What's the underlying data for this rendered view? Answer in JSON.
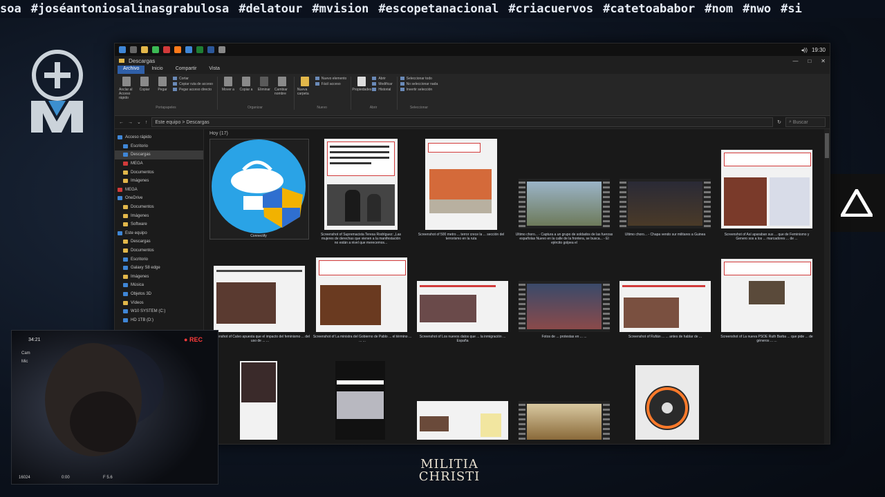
{
  "ticker": [
    "soa",
    "#joséantoniosalinasgrabulosa",
    "#delatour",
    "#mvision",
    "#escopetanacional",
    "#criacuervos",
    "#catetoababor",
    "#nom",
    "#nwo",
    "#si"
  ],
  "colors": {
    "accent": "#2f5fa8",
    "folder": "#e2b74a",
    "rec": "#ff3b3b"
  },
  "watermark": {
    "line1": "MILITIA",
    "line2": "CHRISTI"
  },
  "window": {
    "title": "Descargas",
    "taskbar_time": "19:30",
    "tabs": [
      "Archivo",
      "Inicio",
      "Compartir",
      "Vista"
    ],
    "ribbon": {
      "clipboard": {
        "pin": "Anclar al Acceso rápido",
        "copy": "Copiar",
        "paste": "Pegar",
        "cut": "Cortar",
        "copy_path": "Copiar ruta de acceso",
        "paste_shortcut": "Pegar acceso directo",
        "label": "Portapapeles"
      },
      "organize": {
        "move": "Mover a",
        "copy": "Copiar a",
        "delete": "Eliminar",
        "rename": "Cambiar nombre",
        "label": "Organizar"
      },
      "new": {
        "folder": "Nueva carpeta",
        "new_item": "Nuevo elemento",
        "easy_access": "Fácil acceso",
        "label": "Nuevo"
      },
      "open": {
        "properties": "Propiedades",
        "open": "Abrir",
        "edit": "Modificar",
        "history": "Historial",
        "label": "Abrir"
      },
      "select": {
        "all": "Seleccionar todo",
        "none": "No seleccionar nada",
        "invert": "Invertir selección",
        "label": "Seleccionar"
      }
    },
    "address": "Este equipo  >  Descargas",
    "search_placeholder": "Buscar",
    "nav": [
      {
        "icon": "star",
        "label": "Acceso rápido"
      },
      {
        "icon": "blue",
        "label": "Escritorio"
      },
      {
        "icon": "blue",
        "label": "Descargas",
        "selected": true
      },
      {
        "icon": "red",
        "label": "MEGA"
      },
      {
        "icon": "folder",
        "label": "Documentos"
      },
      {
        "icon": "folder",
        "label": "Imágenes"
      },
      {
        "icon": "red",
        "label": "MEGA"
      },
      {
        "icon": "blue",
        "label": "OneDrive"
      },
      {
        "icon": "folder",
        "label": "Documentos"
      },
      {
        "icon": "folder",
        "label": "Imágenes"
      },
      {
        "icon": "folder",
        "label": "Software"
      },
      {
        "icon": "blue",
        "label": "Este equipo"
      },
      {
        "icon": "folder",
        "label": "Descargas"
      },
      {
        "icon": "folder",
        "label": "Documentos"
      },
      {
        "icon": "blue",
        "label": "Escritorio"
      },
      {
        "icon": "blue",
        "label": "Galaxy S8 edge"
      },
      {
        "icon": "folder",
        "label": "Imágenes"
      },
      {
        "icon": "blue",
        "label": "Música"
      },
      {
        "icon": "blue",
        "label": "Objetos 3D"
      },
      {
        "icon": "folder",
        "label": "Vídeos"
      },
      {
        "icon": "blue",
        "label": "W10 SYSTEM (C:)"
      },
      {
        "icon": "blue",
        "label": "HD 1TB (D:)"
      }
    ],
    "group_header": "Hoy (17)",
    "files": [
      {
        "caption": "Connectify"
      },
      {
        "caption": "Screenshot of Supremacista Teresa Rodríguez: „Las mujeres de derechas que vienen a la manifestación no están a nivel que merecemos..."
      },
      {
        "caption": "Screenshot of 500 metro ... terror crece la ... sección del terrorismo en la ruta"
      },
      {
        "caption": "Último choro... - Captura a un grupo de soldados de las fuerzas españolas Nuevo en la calle de la frontera, se busca... - El ejército golpea el"
      },
      {
        "caption": "Último choro... - Chapa vendo sur militares a Guinea"
      },
      {
        "caption": "Screenshot of Así aparaban sus ... que de Feminismo y Genero sos a los ... marcadores ... de ... "
      },
      {
        "caption": "Screenshot of Calvo apuesta que el impacto del feminismo ... del uso de ... ..."
      },
      {
        "caption": "Screenshot of La ministra del Gobierno de Pablo ... el término ... ... ..."
      },
      {
        "caption": "Screenshot of Los nuevos datos que ... la inmigración ... España"
      },
      {
        "caption": "Fotos de ... protestas en ... ..."
      },
      {
        "caption": "Screenshot of Rufián ... ... antes de hablar de ..."
      },
      {
        "caption": "Screenshot of La nueva PSOE Ruth Barba ... que pide ... de géneros ... ..."
      }
    ]
  },
  "webcam": {
    "header": "34:21",
    "rec": "REC",
    "options": [
      "Cam",
      "Mic"
    ],
    "footer": [
      "16024",
      "0:00",
      "F 5.6"
    ]
  }
}
